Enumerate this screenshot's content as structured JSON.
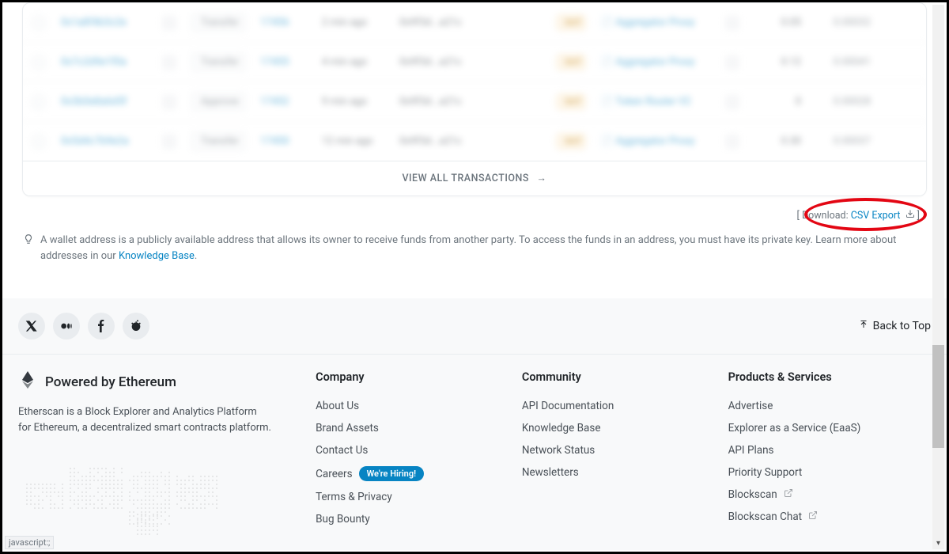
{
  "table": {
    "view_all": "VIEW ALL TRANSACTIONS",
    "rows": [
      {
        "hash": "0x1a8f4b3c2e",
        "method": "Transfer",
        "block": "17456",
        "age": "2 min ago",
        "from": "0x9f3d...a21c",
        "dir": "OUT",
        "to": "Aggregator Proxy",
        "val": "0.05",
        "fee": "0.00032"
      },
      {
        "hash": "0x7c2d9e1f0a",
        "method": "Transfer",
        "block": "17455",
        "age": "4 min ago",
        "from": "0x9f3d...a21c",
        "dir": "OUT",
        "to": "Aggregator Proxy",
        "val": "0.12",
        "fee": "0.00041"
      },
      {
        "hash": "0x3b0e8a6d5f",
        "method": "Approve",
        "block": "17452",
        "age": "9 min ago",
        "from": "0x9f3d...a21c",
        "dir": "OUT",
        "to": "Token Router V2",
        "val": "0",
        "fee": "0.00028"
      },
      {
        "hash": "0x5d4c7b9e2a",
        "method": "Transfer",
        "block": "17450",
        "age": "12 min ago",
        "from": "0x9f3d...a21c",
        "dir": "OUT",
        "to": "Aggregator Proxy",
        "val": "0.30",
        "fee": "0.00037"
      }
    ]
  },
  "download": {
    "prefix": "[ Download: ",
    "link": "CSV Export",
    "suffix": " ]"
  },
  "tip": {
    "text_a": "A wallet address is a publicly available address that allows its owner to receive funds from another party. To access the funds in an address, you must have its private key. Learn more about addresses in our ",
    "link": "Knowledge Base",
    "text_b": "."
  },
  "social": {
    "back_top": "Back to Top"
  },
  "footer": {
    "powered": "Powered by Ethereum",
    "desc": "Etherscan is a Block Explorer and Analytics Platform for Ethereum, a decentralized smart contracts platform.",
    "columns": [
      {
        "title": "Company",
        "items": [
          "About Us",
          "Brand Assets",
          "Contact Us",
          "Careers",
          "Terms & Privacy",
          "Bug Bounty"
        ],
        "hiring_index": 3,
        "hiring_text": "We're Hiring!"
      },
      {
        "title": "Community",
        "items": [
          "API Documentation",
          "Knowledge Base",
          "Network Status",
          "Newsletters"
        ]
      },
      {
        "title": "Products & Services",
        "items": [
          "Advertise",
          "Explorer as a Service (EaaS)",
          "API Plans",
          "Priority Support",
          "Blockscan",
          "Blockscan Chat"
        ],
        "ext_indices": [
          4,
          5
        ]
      }
    ]
  },
  "status": "javascript:;"
}
